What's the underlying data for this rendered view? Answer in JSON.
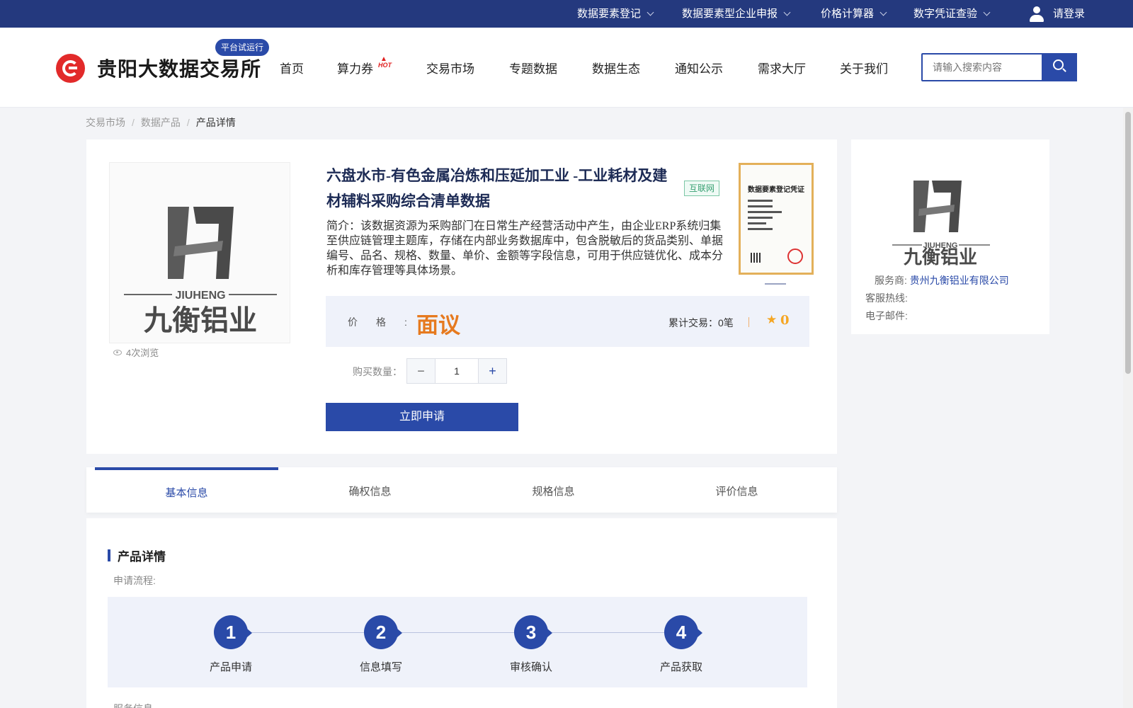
{
  "topbar": {
    "links": [
      "数据要素登记",
      "数据要素型企业申报",
      "价格计算器",
      "数字凭证查验"
    ],
    "login": "请登录"
  },
  "header": {
    "brand": "贵阳大数据交易所",
    "trial_badge": "平台试运行",
    "nav": [
      "首页",
      "算力券",
      "交易市场",
      "专题数据",
      "数据生态",
      "通知公示",
      "需求大厅",
      "关于我们"
    ],
    "hot_label": "HOT",
    "search_placeholder": "请输入搜索内容"
  },
  "breadcrumb": [
    "交易市场",
    "数据产品",
    "产品详情"
  ],
  "product": {
    "title": "六盘水市-有色金属冶炼和压延加工业 -工业耗材及建材辅料采购综合清单数据",
    "tag": "互联网",
    "intro": "简介：该数据资源为采购部门在日常生产经营活动中产生，由企业ERP系统归集至供应链管理主题库，存储在内部业务数据库中，包含脱敏后的货品类别、单据编号、品名、规格、数量、单价、金额等字段信息，可用于供应链优化、成本分析和库存管理等具体场景。",
    "views": "4次浏览",
    "logo_en": "JIUHENG",
    "logo_cn": "九衡铝业",
    "certificate_title": "数据要素登记凭证",
    "price_label": "价格",
    "price_value": "面议",
    "trade_count": "累计交易：0笔",
    "rating": "0",
    "quantity_label": "购买数量：",
    "quantity_value": "1",
    "apply_button": "立即申请"
  },
  "provider": {
    "service_label": "服务商:",
    "service_value": "贵州九衡铝业有限公司",
    "hotline_label": "客服热线:",
    "email_label": "电子邮件:"
  },
  "tabs": [
    "基本信息",
    "确权信息",
    "规格信息",
    "评价信息"
  ],
  "detail": {
    "section_title": "产品详情",
    "flow_label": "申请流程:",
    "steps": [
      {
        "num": "1",
        "label": "产品申请"
      },
      {
        "num": "2",
        "label": "信息填写"
      },
      {
        "num": "3",
        "label": "审核确认"
      },
      {
        "num": "4",
        "label": "产品获取"
      }
    ],
    "service_info_label": "服务信息"
  },
  "colors": {
    "primary": "#2a4aa8",
    "topbar": "#24397e",
    "price": "#e67a1f",
    "logo_red": "#e22a2a"
  }
}
